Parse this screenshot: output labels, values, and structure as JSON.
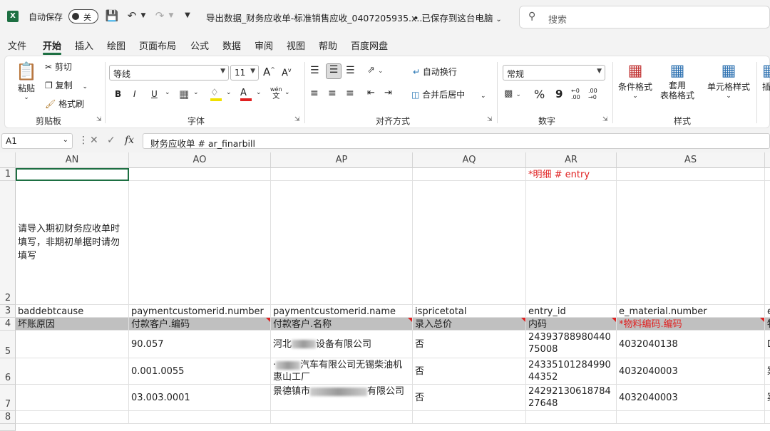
{
  "titlebar": {
    "autosave_label": "自动保存",
    "autosave_state": "关",
    "doc_title": "导出数据_财务应收单-标准销售应收_0407205935.x...",
    "save_status": "• 已保存到这台电脑",
    "search_placeholder": "搜索"
  },
  "tabs": [
    "文件",
    "开始",
    "插入",
    "绘图",
    "页面布局",
    "公式",
    "数据",
    "审阅",
    "视图",
    "帮助",
    "百度网盘"
  ],
  "ribbon": {
    "clipboard": {
      "label": "剪贴板",
      "paste": "粘贴",
      "cut": "剪切",
      "copy": "复制",
      "format_painter": "格式刷"
    },
    "font": {
      "label": "字体",
      "font_name": "等线",
      "font_size": "11",
      "bold": "B",
      "italic": "I",
      "underline": "U",
      "phonetic_top": "wén",
      "phonetic_bottom": "文"
    },
    "alignment": {
      "label": "对齐方式",
      "wrap": "自动换行",
      "merge": "合并后居中"
    },
    "number": {
      "label": "数字",
      "format": "常规",
      "percent": "%",
      "comma": "9",
      "inc": "←0 .00",
      "dec": ".00 →0"
    },
    "styles": {
      "label": "样式",
      "conditional": "条件格式",
      "table_line1": "套用",
      "table_line2": "表格格式",
      "cell_styles": "单元格样式",
      "insert_partial": "插"
    }
  },
  "formula_bar": {
    "name_box": "A1",
    "fx": "fx",
    "formula": "财务应收单 # ar_finarbill"
  },
  "columns": [
    "AN",
    "AO",
    "AP",
    "AQ",
    "AR",
    "AS"
  ],
  "rows": [
    "1",
    "2",
    "3",
    "4",
    "5",
    "6",
    "7",
    "8"
  ],
  "cells": {
    "ar1": "*明细 # entry",
    "an2": "请导入期初财务应收单时填写，非期初单据时请勿填写",
    "an3": "baddebtcause",
    "ao3": "paymentcustomerid.number",
    "ap3": "paymentcustomerid.name",
    "aq3": "ispricetotal",
    "ar3": "entry_id",
    "as3": "e_material.number",
    "at3": "e",
    "an4": "坏账原因",
    "ao4": "付款客户.编码",
    "ap4": "付款客户.名称",
    "aq4": "录入总价",
    "ar4": "内码",
    "as4": "*物料编码.编码",
    "at4": "物",
    "ao5": "90.057",
    "ap5_pre": "河北",
    "ap5_post": "设备有限公司",
    "aq5": "否",
    "ar5": "2439378898044075008",
    "as5": "4032040138",
    "at5": "D",
    "ao6": "0.001.0055",
    "ap6_pre": "·",
    "ap6_post": "汽车有限公司无锡柴油机惠山工厂",
    "aq6": "否",
    "ar6": "2433510128499044352",
    "as6": "4032040003",
    "at6": "案",
    "ao7": "03.003.0001",
    "ap7_pre": "景德镇市",
    "ap7_post": "有限公司",
    "aq7": "否",
    "ar7": "2429213061878427648",
    "as7": "4032040003",
    "at7": "案"
  }
}
